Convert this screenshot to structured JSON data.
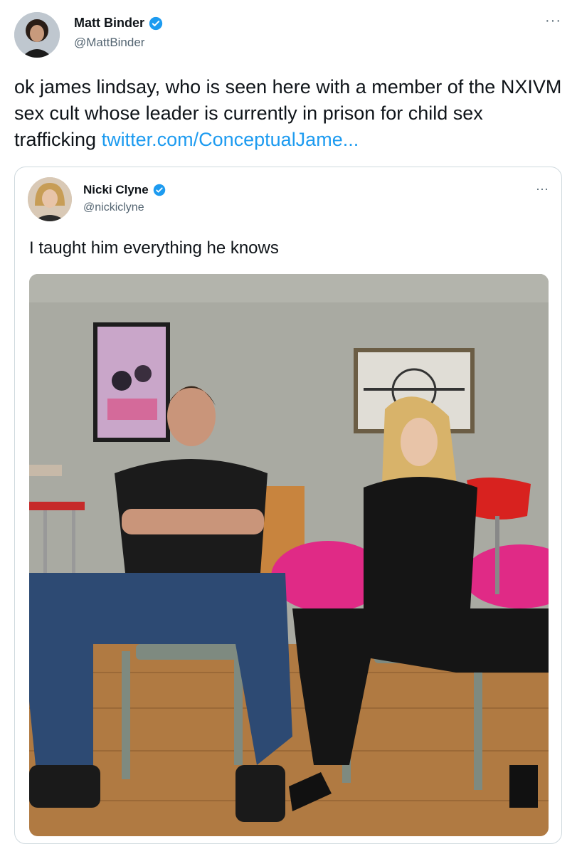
{
  "author": {
    "name": "Matt Binder",
    "handle": "@MattBinder",
    "verified": true,
    "more_label": "···"
  },
  "tweet": {
    "text": "ok james lindsay, who is seen here with a member of the NXIVM sex cult whose leader is currently in prison for child sex trafficking ",
    "link_text": "twitter.com/ConceptualJame..."
  },
  "quoted": {
    "name": "Nicki Clyne",
    "handle": "@nickiclyne",
    "verified": true,
    "more_label": "···",
    "text": "I taught him everything he knows"
  },
  "colors": {
    "link": "#1d9bf0",
    "verified": "#1d9bf0",
    "border": "#cfd9de"
  }
}
